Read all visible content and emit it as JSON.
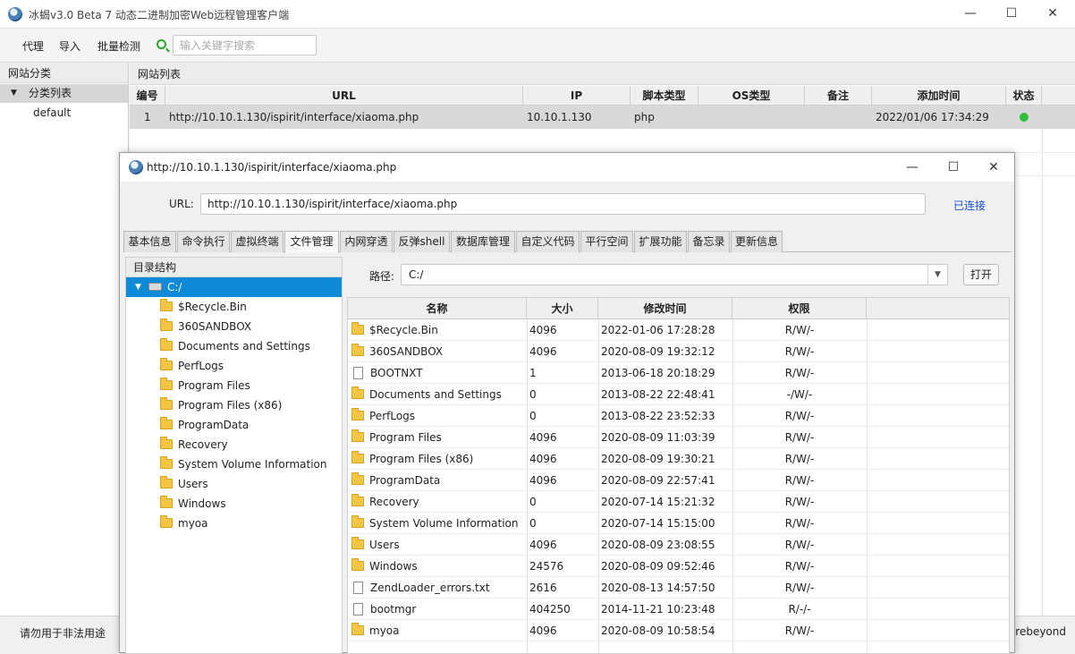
{
  "main_window": {
    "title": "冰蝎v3.0 Beta 7 动态二进制加密Web远程管理客户端",
    "controls": {
      "minimize": "—",
      "maximize": "☐",
      "close": "✕"
    }
  },
  "menu": {
    "items": [
      "代理",
      "导入",
      "批量检测"
    ],
    "search_placeholder": "输入关键字搜索"
  },
  "categories": {
    "header": "网站分类",
    "root": "分类列表",
    "items": [
      "default"
    ]
  },
  "site_list": {
    "header": "网站列表",
    "columns": [
      "编号",
      "URL",
      "IP",
      "脚本类型",
      "OS类型",
      "备注",
      "添加时间",
      "状态"
    ],
    "rows": [
      {
        "id": "1",
        "url": "http://10.10.1.130/ispirit/interface/xiaoma.php",
        "ip": "10.10.1.130",
        "script": "php",
        "os": "",
        "note": "",
        "added": "2022/01/06 17:34:29",
        "status": "online"
      }
    ]
  },
  "status_bar": {
    "left": "请勿用于非法用途",
    "right": "rebeyond"
  },
  "shell_window": {
    "title": "http://10.10.1.130/ispirit/interface/xiaoma.php",
    "url_label": "URL:",
    "url_value": "http://10.10.1.130/ispirit/interface/xiaoma.php",
    "connection_status": "已连接",
    "tabs": [
      "基本信息",
      "命令执行",
      "虚拟终端",
      "文件管理",
      "内网穿透",
      "反弹shell",
      "数据库管理",
      "自定义代码",
      "平行空间",
      "扩展功能",
      "备忘录",
      "更新信息"
    ],
    "active_tab": "文件管理",
    "dir_tree": {
      "header": "目录结构",
      "root": "C:/",
      "children": [
        "$Recycle.Bin",
        "360SANDBOX",
        "Documents and Settings",
        "PerfLogs",
        "Program Files",
        "Program Files (x86)",
        "ProgramData",
        "Recovery",
        "System Volume Information",
        "Users",
        "Windows",
        "myoa"
      ]
    },
    "path_label": "路径:",
    "path_value": "C:/",
    "open_button": "打开",
    "file_columns": [
      "名称",
      "大小",
      "修改时间",
      "权限"
    ],
    "files": [
      {
        "name": "$Recycle.Bin",
        "size": "4096",
        "modified": "2022-01-06 17:28:28",
        "perm": "R/W/-",
        "type": "folder"
      },
      {
        "name": "360SANDBOX",
        "size": "4096",
        "modified": "2020-08-09 19:32:12",
        "perm": "R/W/-",
        "type": "folder"
      },
      {
        "name": "BOOTNXT",
        "size": "1",
        "modified": "2013-06-18 20:18:29",
        "perm": "R/W/-",
        "type": "file"
      },
      {
        "name": "Documents and Settings",
        "size": "0",
        "modified": "2013-08-22 22:48:41",
        "perm": "-/W/-",
        "type": "folder"
      },
      {
        "name": "PerfLogs",
        "size": "0",
        "modified": "2013-08-22 23:52:33",
        "perm": "R/W/-",
        "type": "folder"
      },
      {
        "name": "Program Files",
        "size": "4096",
        "modified": "2020-08-09 11:03:39",
        "perm": "R/W/-",
        "type": "folder"
      },
      {
        "name": "Program Files (x86)",
        "size": "4096",
        "modified": "2020-08-09 19:30:21",
        "perm": "R/W/-",
        "type": "folder"
      },
      {
        "name": "ProgramData",
        "size": "4096",
        "modified": "2020-08-09 22:57:41",
        "perm": "R/W/-",
        "type": "folder"
      },
      {
        "name": "Recovery",
        "size": "0",
        "modified": "2020-07-14 15:21:32",
        "perm": "R/W/-",
        "type": "folder"
      },
      {
        "name": "System Volume Information",
        "size": "0",
        "modified": "2020-07-14 15:15:00",
        "perm": "R/W/-",
        "type": "folder"
      },
      {
        "name": "Users",
        "size": "4096",
        "modified": "2020-08-09 23:08:55",
        "perm": "R/W/-",
        "type": "folder"
      },
      {
        "name": "Windows",
        "size": "24576",
        "modified": "2020-08-09 09:52:46",
        "perm": "R/W/-",
        "type": "folder"
      },
      {
        "name": "ZendLoader_errors.txt",
        "size": "2616",
        "modified": "2020-08-13 14:57:50",
        "perm": "R/W/-",
        "type": "file"
      },
      {
        "name": "bootmgr",
        "size": "404250",
        "modified": "2014-11-21 10:23:48",
        "perm": "R/-/-",
        "type": "file"
      },
      {
        "name": "myoa",
        "size": "4096",
        "modified": "2020-08-09 10:58:54",
        "perm": "R/W/-",
        "type": "folder"
      }
    ]
  }
}
